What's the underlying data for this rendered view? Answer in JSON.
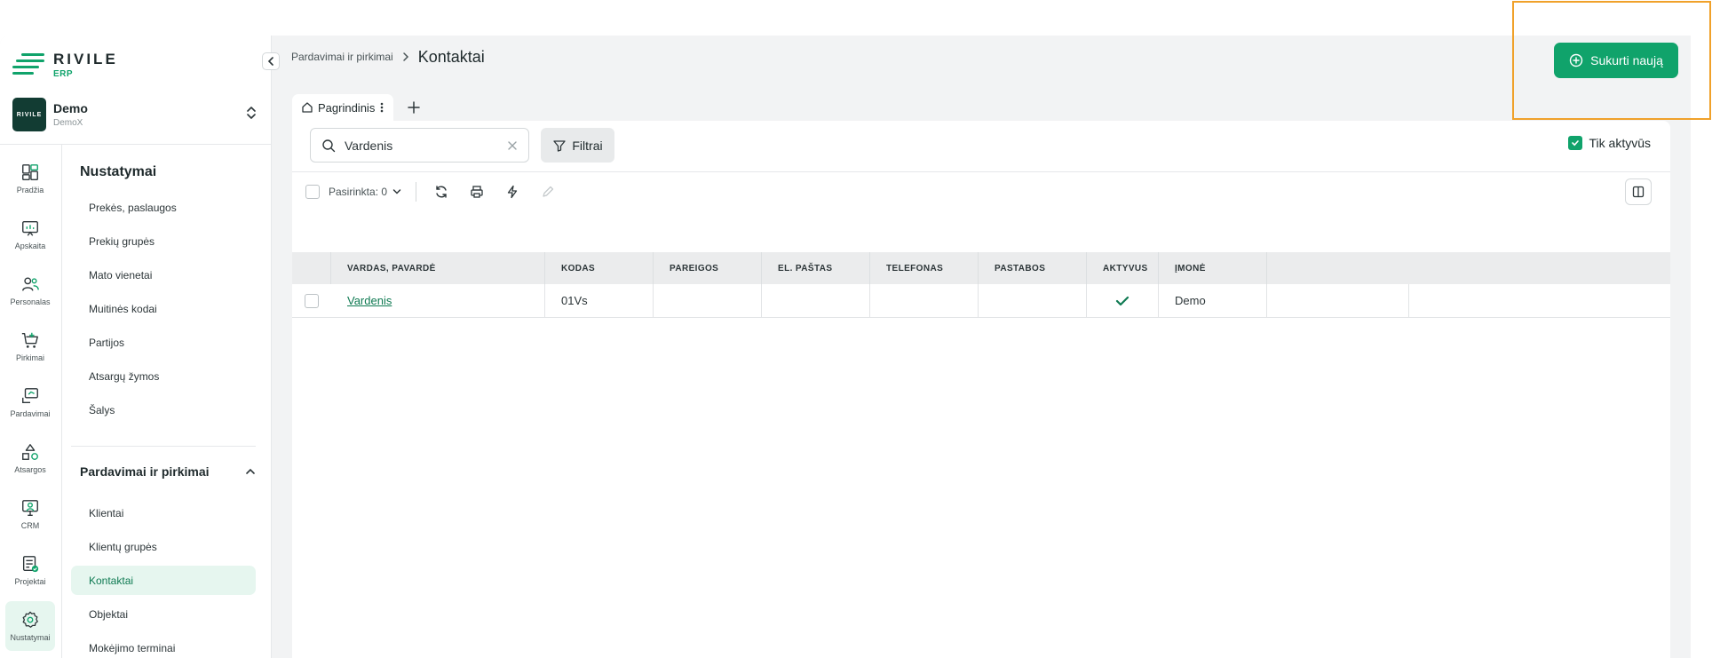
{
  "brand": {
    "name": "RIVILE",
    "sub": "ERP"
  },
  "company": {
    "name": "Demo",
    "sub": "DemoX",
    "avatar_text": "RIVILE"
  },
  "rail": [
    {
      "label": "Pradžia",
      "icon": "dashboard-icon"
    },
    {
      "label": "Apskaita",
      "icon": "accounting-icon"
    },
    {
      "label": "Personalas",
      "icon": "people-icon"
    },
    {
      "label": "Pirkimai",
      "icon": "cart-icon"
    },
    {
      "label": "Pardavimai",
      "icon": "sales-icon"
    },
    {
      "label": "Atsargos",
      "icon": "shapes-icon"
    },
    {
      "label": "CRM",
      "icon": "crm-icon"
    },
    {
      "label": "Projektai",
      "icon": "projects-icon"
    },
    {
      "label": "Nustatymai",
      "icon": "settings-icon",
      "active": true
    }
  ],
  "menu": {
    "title": "Nustatymai",
    "items": [
      "Prekės, paslaugos",
      "Prekių grupės",
      "Mato vienetai",
      "Muitinės kodai",
      "Partijos",
      "Atsargų žymos",
      "Šalys"
    ],
    "section": "Pardavimai ir pirkimai",
    "section_items": [
      "Klientai",
      "Klientų grupės",
      "Kontaktai",
      "Objektai",
      "Mokėjimo terminai"
    ],
    "active": "Kontaktai"
  },
  "breadcrumb": {
    "parent": "Pardavimai ir pirkimai",
    "current": "Kontaktai"
  },
  "create_button": "Sukurti naują",
  "tabs": [
    {
      "label": "Pagrindinis"
    }
  ],
  "search": {
    "value": "Vardenis"
  },
  "filter_button": "Filtrai",
  "only_active": {
    "label": "Tik aktyvūs",
    "checked": true
  },
  "toolbar": {
    "selected": "Pasirinkta: 0"
  },
  "table": {
    "columns": [
      "VARDAS, PAVARDĖ",
      "KODAS",
      "PAREIGOS",
      "EL. PAŠTAS",
      "TELEFONAS",
      "PASTABOS",
      "AKTYVUS",
      "ĮMONĖ"
    ],
    "rows": [
      {
        "name": "Vardenis",
        "code": "01Vs",
        "position": "",
        "email": "",
        "phone": "",
        "notes": "",
        "active": true,
        "company": "Demo"
      }
    ]
  },
  "colors": {
    "accent": "#10a36b",
    "highlight": "#f0a12a"
  }
}
